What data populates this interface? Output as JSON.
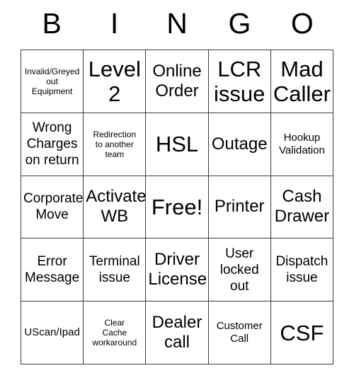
{
  "card": {
    "header": {
      "letters": [
        "B",
        "I",
        "N",
        "G",
        "O"
      ]
    },
    "rows": [
      [
        {
          "text": "Invalid/Greyed\nout\nEquipment",
          "size": "xs"
        },
        {
          "text": "Level\n2",
          "size": "xl"
        },
        {
          "text": "Online\nOrder",
          "size": "l"
        },
        {
          "text": "LCR\nissue",
          "size": "xl"
        },
        {
          "text": "Mad\nCaller",
          "size": "xl"
        }
      ],
      [
        {
          "text": "Wrong\nCharges\non return",
          "size": "m"
        },
        {
          "text": "Redirection\nto another\nteam",
          "size": "xs"
        },
        {
          "text": "HSL",
          "size": "xl"
        },
        {
          "text": "Outage",
          "size": "l"
        },
        {
          "text": "Hookup\nValidation",
          "size": "s"
        }
      ],
      [
        {
          "text": "Corporate\nMove",
          "size": "m"
        },
        {
          "text": "Activate\nWB",
          "size": "l"
        },
        {
          "text": "Free!",
          "size": "xl"
        },
        {
          "text": "Printer",
          "size": "l"
        },
        {
          "text": "Cash\nDrawer",
          "size": "l"
        }
      ],
      [
        {
          "text": "Error\nMessage",
          "size": "m"
        },
        {
          "text": "Terminal\nissue",
          "size": "m"
        },
        {
          "text": "Driver\nLicense",
          "size": "l"
        },
        {
          "text": "User\nlocked\nout",
          "size": "m"
        },
        {
          "text": "Dispatch\nissue",
          "size": "m"
        }
      ],
      [
        {
          "text": "UScan/Ipad",
          "size": "s"
        },
        {
          "text": "Clear\nCache\nworkaround",
          "size": "xs"
        },
        {
          "text": "Dealer\ncall",
          "size": "l"
        },
        {
          "text": "Customer\nCall",
          "size": "s"
        },
        {
          "text": "CSF",
          "size": "xl"
        }
      ]
    ],
    "colors": {
      "border": "#3a3a3a",
      "text": "#000000",
      "background": "#ffffff"
    }
  }
}
